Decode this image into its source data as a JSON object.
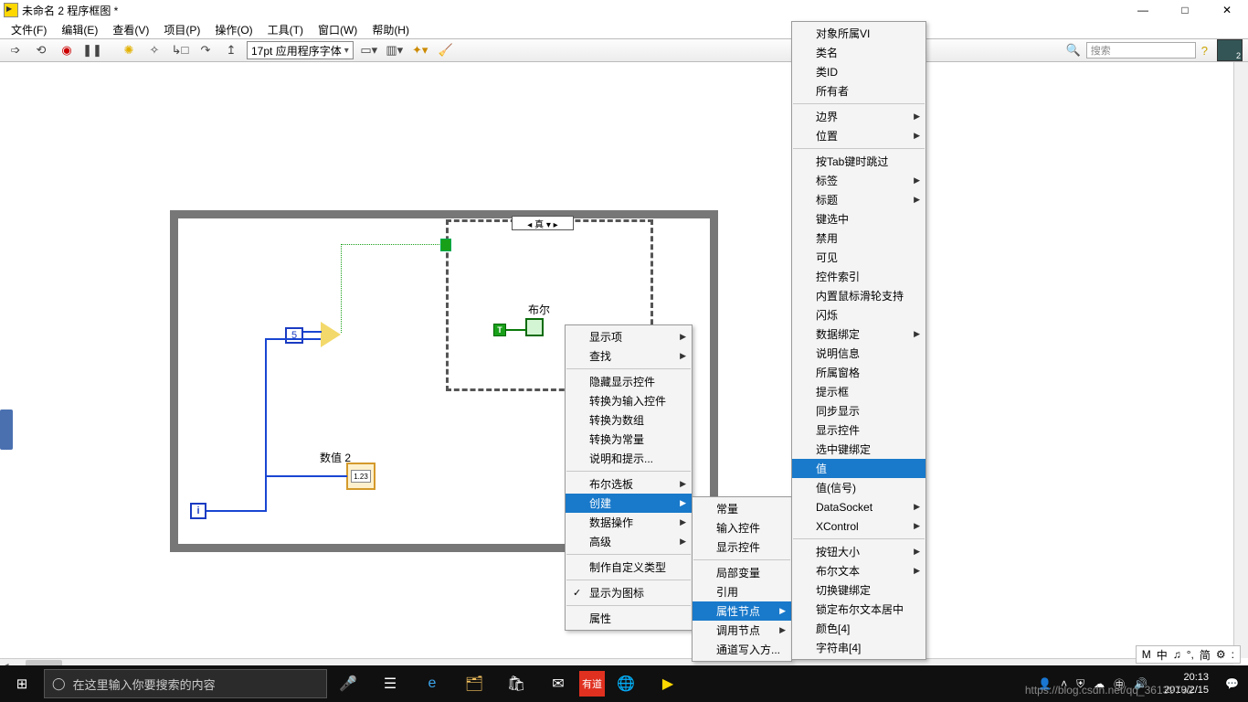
{
  "window": {
    "title": "未命名 2 程序框图 *",
    "min_tip": "—",
    "max_tip": "□",
    "close_tip": "✕"
  },
  "menubar": [
    "文件(F)",
    "编辑(E)",
    "查看(V)",
    "项目(P)",
    "操作(O)",
    "工具(T)",
    "窗口(W)",
    "帮助(H)"
  ],
  "toolbar": {
    "font": "17pt 应用程序字体",
    "search_placeholder": "搜索"
  },
  "diagram": {
    "case_label": "◂ 真 ▾ ▸",
    "bool_label": "布尔",
    "const_t": "T",
    "const_5": "5",
    "iterm": "i",
    "num_label": "数值 2",
    "num_inner": "1.23",
    "num_type": "DBL"
  },
  "context_menu_1": [
    {
      "t": "显示项",
      "sub": true
    },
    {
      "t": "查找",
      "sub": true
    },
    {
      "sep": true
    },
    {
      "t": "隐藏显示控件"
    },
    {
      "t": "转换为输入控件"
    },
    {
      "t": "转换为数组"
    },
    {
      "t": "转换为常量"
    },
    {
      "t": "说明和提示..."
    },
    {
      "sep": true
    },
    {
      "t": "布尔选板",
      "sub": true
    },
    {
      "t": "创建",
      "sub": true,
      "hl": true
    },
    {
      "t": "数据操作",
      "sub": true
    },
    {
      "t": "高级",
      "sub": true
    },
    {
      "sep": true
    },
    {
      "t": "制作自定义类型"
    },
    {
      "sep": true
    },
    {
      "t": "显示为图标",
      "chk": true
    },
    {
      "sep": true
    },
    {
      "t": "属性"
    }
  ],
  "context_menu_2": [
    {
      "t": "常量"
    },
    {
      "t": "输入控件"
    },
    {
      "t": "显示控件"
    },
    {
      "sep": true
    },
    {
      "t": "局部变量"
    },
    {
      "t": "引用"
    },
    {
      "t": "属性节点",
      "sub": true,
      "hl": true
    },
    {
      "t": "调用节点",
      "sub": true
    },
    {
      "t": "通道写入方..."
    }
  ],
  "context_menu_3": [
    {
      "t": "对象所属VI"
    },
    {
      "t": "类名"
    },
    {
      "t": "类ID"
    },
    {
      "t": "所有者"
    },
    {
      "sep": true
    },
    {
      "t": "边界",
      "sub": true
    },
    {
      "t": "位置",
      "sub": true
    },
    {
      "sep": true
    },
    {
      "t": "按Tab键时跳过"
    },
    {
      "t": "标签",
      "sub": true
    },
    {
      "t": "标题",
      "sub": true
    },
    {
      "t": "键选中"
    },
    {
      "t": "禁用"
    },
    {
      "t": "可见"
    },
    {
      "t": "控件索引"
    },
    {
      "t": "内置鼠标滑轮支持"
    },
    {
      "t": "闪烁"
    },
    {
      "t": "数据绑定",
      "sub": true
    },
    {
      "t": "说明信息"
    },
    {
      "t": "所属窗格"
    },
    {
      "t": "提示框"
    },
    {
      "t": "同步显示"
    },
    {
      "t": "显示控件"
    },
    {
      "t": "选中键绑定"
    },
    {
      "t": "值",
      "hl": true
    },
    {
      "t": "值(信号)"
    },
    {
      "t": "DataSocket",
      "sub": true
    },
    {
      "t": "XControl",
      "sub": true
    },
    {
      "sep": true
    },
    {
      "t": "按钮大小",
      "sub": true
    },
    {
      "t": "布尔文本",
      "sub": true
    },
    {
      "t": "切换键绑定"
    },
    {
      "t": "锁定布尔文本居中"
    },
    {
      "t": "颜色[4]"
    },
    {
      "t": "字符串[4]"
    }
  ],
  "imebar": [
    "M",
    "中",
    "♫",
    "°,",
    "简",
    "⚙",
    ":"
  ],
  "taskbar": {
    "search_placeholder": "在这里输入你要搜索的内容",
    "time": "20:13",
    "date": "2019/2/15"
  },
  "watermark": "https://blog.csdn.net/qq_36139702"
}
